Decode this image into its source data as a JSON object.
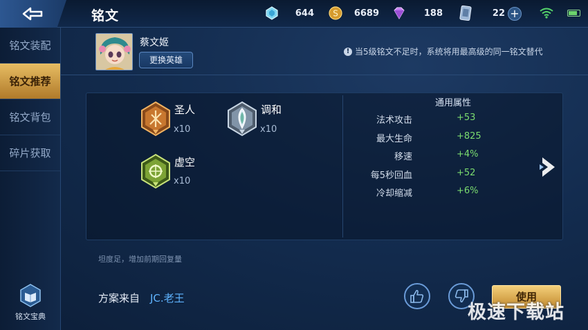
{
  "header": {
    "title": "铭文",
    "resources": [
      {
        "icon": "diamond-icon",
        "value": "644"
      },
      {
        "icon": "gold-coin-icon",
        "value": "6689"
      },
      {
        "icon": "purple-crystal-icon",
        "value": "188"
      },
      {
        "icon": "voucher-icon",
        "value": "22"
      }
    ],
    "plus_label": "+"
  },
  "sidebar": {
    "items": [
      {
        "label": "铭文装配",
        "active": false
      },
      {
        "label": "铭文推荐",
        "active": true
      },
      {
        "label": "铭文背包",
        "active": false
      },
      {
        "label": "碎片获取",
        "active": false
      }
    ],
    "codex_label": "铭文宝典"
  },
  "hero": {
    "name": "蔡文姬",
    "change_button": "更换英雄"
  },
  "notice": {
    "icon": "info-icon",
    "text": "当5级铭文不足时，系统将用最高级的同一铭文替代"
  },
  "runes": [
    {
      "name": "圣人",
      "count": "x10",
      "color": "#b5692a"
    },
    {
      "name": "调和",
      "count": "x10",
      "color": "#8ea0b2"
    },
    {
      "name": "虚空",
      "count": "x10",
      "color": "#6f9b2f"
    }
  ],
  "attributes": {
    "title": "通用属性",
    "rows": [
      {
        "label": "法术攻击",
        "value": "+53"
      },
      {
        "label": "最大生命",
        "value": "+825"
      },
      {
        "label": "移速",
        "value": "+4%"
      },
      {
        "label": "每5秒回血",
        "value": "+52"
      },
      {
        "label": "冷却缩减",
        "value": "+6%"
      }
    ]
  },
  "description": "坦度足，增加前期回复量",
  "source": {
    "label": "方案来自",
    "author": "JC.老王"
  },
  "actions": {
    "use_label": "使用"
  },
  "watermark": "极速下载站",
  "colors": {
    "accent_gold": "#e7bd63",
    "attribute_green": "#7bdc6f",
    "author_blue": "#5fb4ff",
    "background": "#132c4f"
  }
}
